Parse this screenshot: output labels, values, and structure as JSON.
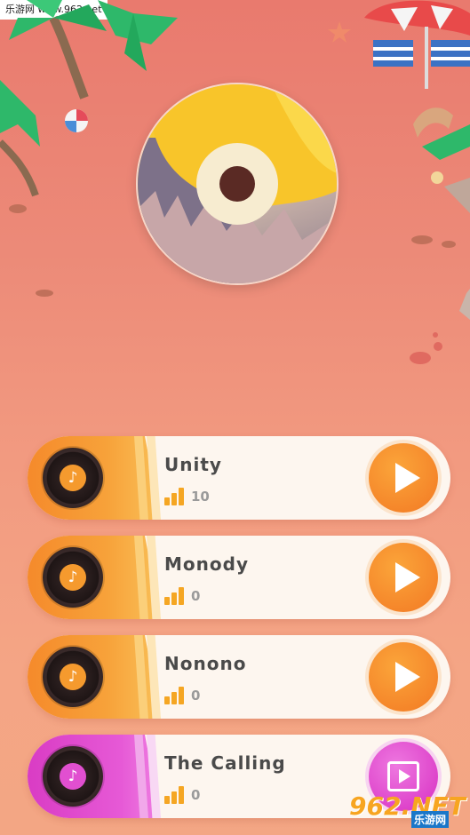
{
  "watermark_top": "乐游网 www.962.net",
  "watermark_bottom": {
    "logo": "962.NET",
    "sub": "乐游网"
  },
  "colors": {
    "orange": "#f58a2b",
    "pink": "#d93cc4",
    "background": "#ec8a78"
  },
  "songs": [
    {
      "title": "Unity",
      "score": "10",
      "theme": "orange",
      "action_icon": "play-icon"
    },
    {
      "title": "Monody",
      "score": "0",
      "theme": "orange",
      "action_icon": "play-icon"
    },
    {
      "title": "Nonono",
      "score": "0",
      "theme": "orange",
      "action_icon": "play-icon"
    },
    {
      "title": "The Calling",
      "score": "0",
      "theme": "pink",
      "action_icon": "video-icon"
    }
  ]
}
